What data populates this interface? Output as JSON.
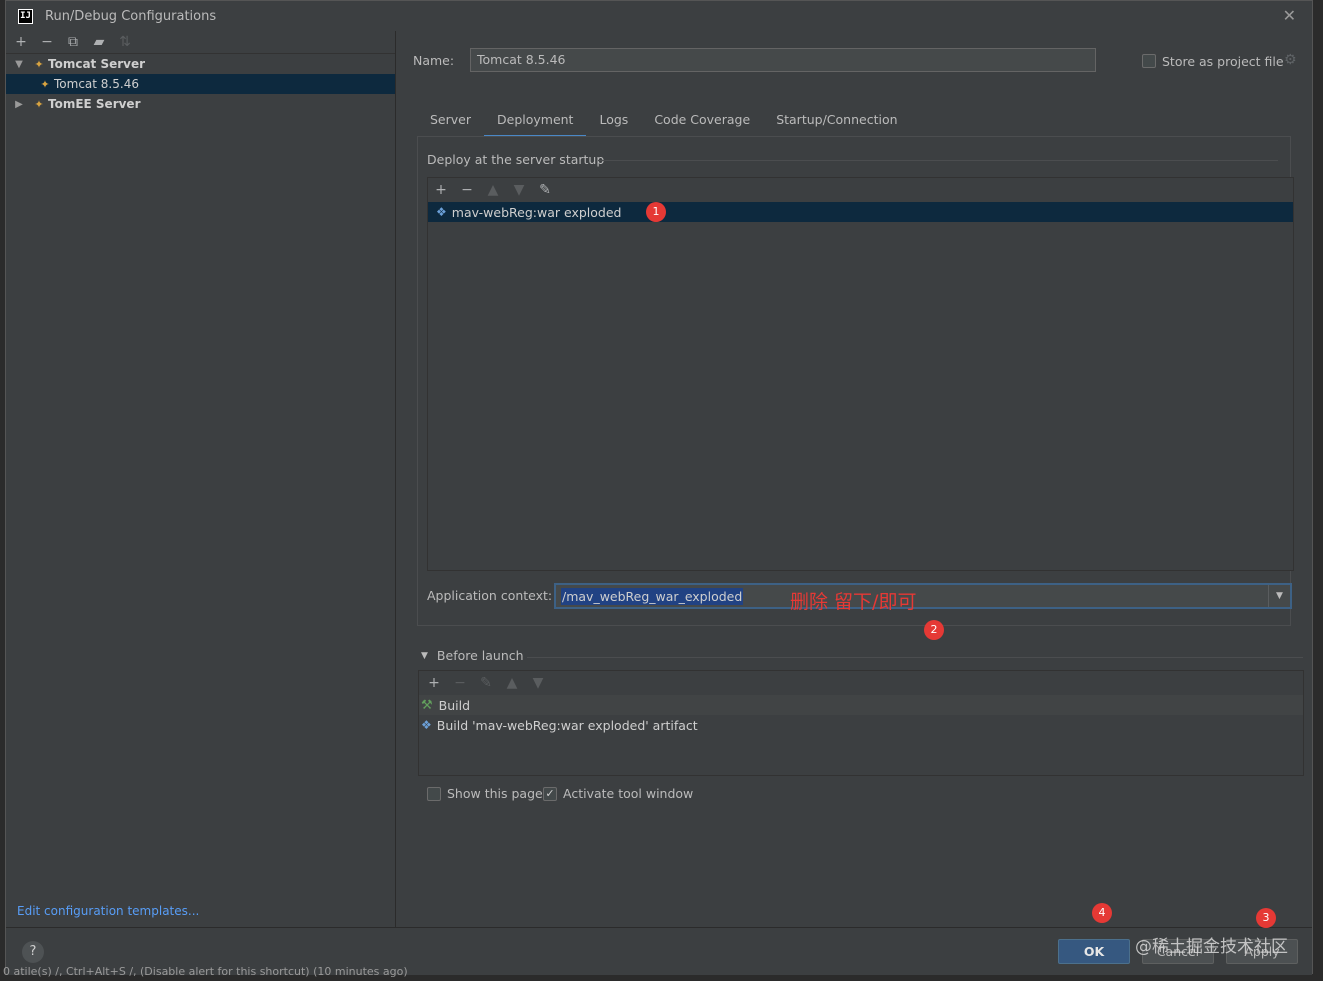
{
  "window": {
    "title": "Run/Debug Configurations",
    "app_icon": "IJ"
  },
  "left": {
    "toolbar": [
      "add-icon",
      "remove-icon",
      "copy-icon",
      "folder-icon",
      "sort-icon"
    ],
    "tree": {
      "group1": "Tomcat Server",
      "group1_child": "Tomcat 8.5.46",
      "group2": "TomEE Server"
    },
    "edit_templates": "Edit configuration templates..."
  },
  "right": {
    "name_label": "Name:",
    "name_value": "Tomcat 8.5.46",
    "store_label": "Store as project file",
    "tabs": [
      "Server",
      "Deployment",
      "Logs",
      "Code Coverage",
      "Startup/Connection"
    ],
    "active_tab": "Deployment",
    "deploy_title": "Deploy at the server startup",
    "artifact": "mav-webReg:war exploded",
    "context_label": "Application context:",
    "context_value": "/mav_webReg_war_exploded",
    "annotation": "删除 留下/即可",
    "before_launch": "Before launch",
    "before_items": [
      "Build",
      "Build 'mav-webReg:war exploded' artifact"
    ],
    "show_page": "Show this page",
    "activate_window": "Activate tool window"
  },
  "buttons": {
    "ok": "OK",
    "cancel": "Cancel",
    "apply": "Apply",
    "help": "?"
  },
  "badges": [
    "1",
    "2",
    "3",
    "4"
  ],
  "watermark": "@稀土掘金技术社区",
  "status_strip": "0 atile(s) /,   Ctrl+Alt+S /, (Disable alert for this shortcut) (10 minutes ago)",
  "colors": {
    "selection": "#0d293e",
    "accent": "#4a88c7",
    "ok_button": "#365880",
    "annotation": "#e53935",
    "link": "#589df6"
  }
}
